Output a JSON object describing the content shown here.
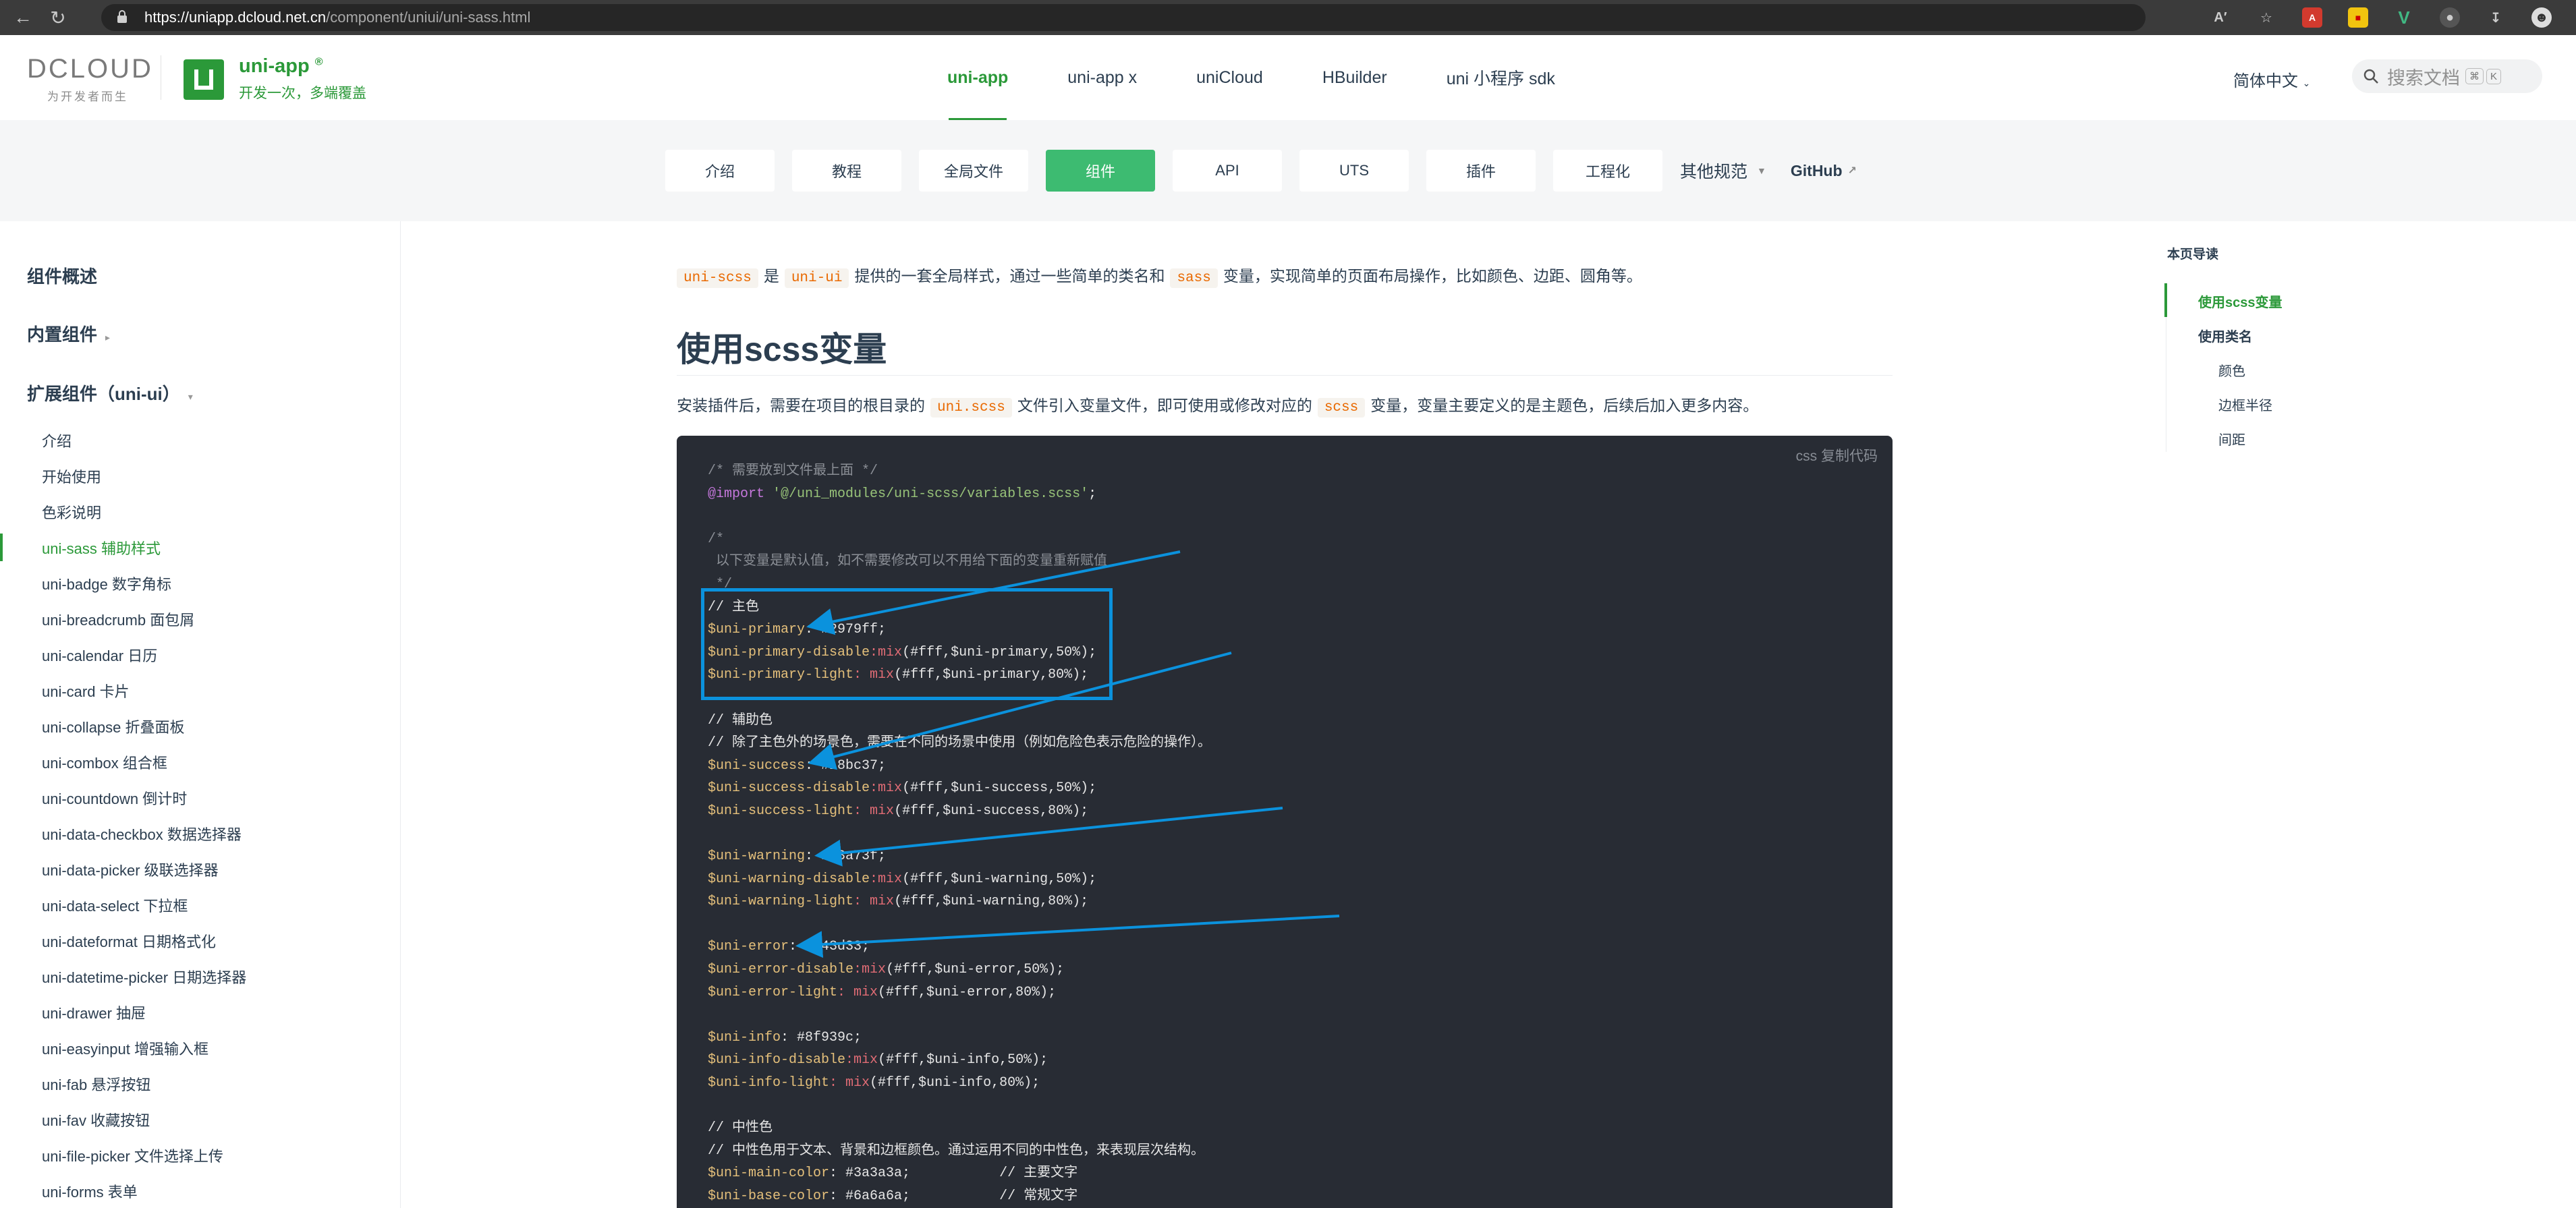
{
  "browser": {
    "url_host": "https://uniapp.dcloud.net.cn",
    "url_path": "/component/uniui/uni-sass.html"
  },
  "header": {
    "logo_text": "DCLOUD",
    "logo_sub": "为开发者而生",
    "brand_title": "uni-app",
    "brand_reg": "®",
    "brand_sub": "开发一次，多端覆盖",
    "nav": [
      "uni-app",
      "uni-app x",
      "uniCloud",
      "HBuilder",
      "uni 小程序 sdk"
    ],
    "lang": "简体中文",
    "search_placeholder": "搜索文档",
    "kbd1": "⌘",
    "kbd2": "K"
  },
  "subnav": {
    "items": [
      "介绍",
      "教程",
      "全局文件",
      "组件",
      "API",
      "UTS",
      "插件",
      "工程化"
    ],
    "other": "其他规范",
    "github": "GitHub"
  },
  "sidebar": {
    "overview": "组件概述",
    "builtin": "内置组件",
    "extended": "扩展组件（uni-ui）",
    "items": [
      "介绍",
      "开始使用",
      "色彩说明",
      "uni-sass 辅助样式",
      "uni-badge 数字角标",
      "uni-breadcrumb 面包屑",
      "uni-calendar 日历",
      "uni-card 卡片",
      "uni-collapse 折叠面板",
      "uni-combox 组合框",
      "uni-countdown 倒计时",
      "uni-data-checkbox 数据选择器",
      "uni-data-picker 级联选择器",
      "uni-data-select 下拉框",
      "uni-dateformat 日期格式化",
      "uni-datetime-picker 日期选择器",
      "uni-drawer 抽屉",
      "uni-easyinput 增强输入框",
      "uni-fab 悬浮按钮",
      "uni-fav 收藏按钮",
      "uni-file-picker 文件选择上传",
      "uni-forms 表单"
    ]
  },
  "content": {
    "intro_code1": "uni-scss",
    "intro_t1": "是",
    "intro_code2": "uni-ui",
    "intro_t2": "提供的一套全局样式，通过一些简单的类名和",
    "intro_code3": "sass",
    "intro_t3": "变量，实现简单的页面布局操作，比如颜色、边距、圆角等。",
    "heading": "使用scss变量",
    "install_t1": "安装插件后，需要在项目的根目录的",
    "install_code1": "uni.scss",
    "install_t2": "文件引入变量文件，即可使用或修改对应的",
    "install_code2": "scss",
    "install_t3": "变量，变量主要定义的是主题色，后续后加入更多内容。",
    "copy_label": "css 复制代码",
    "code": {
      "l1": "/* 需要放到文件最上面 */",
      "l2_kw": "@import",
      "l2_str": "'@/uni_modules/uni-scss/variables.scss'",
      "l2_end": ";",
      "l3": "/*",
      "l4": " 以下变量是默认值，如不需要修改可以不用给下面的变量重新赋值",
      "l5": " */",
      "l6": "// 主色",
      "l7_var": "$uni-primary",
      "l7_val": ": #2979ff;",
      "l8_var": "$uni-primary-disable",
      "l8_fn": ":mix",
      "l8_val": "(#fff,$uni-primary,50%);",
      "l9_var": "$uni-primary-light",
      "l9_fn": ": mix",
      "l9_val": "(#fff,$uni-primary,80%);",
      "l10": "// 辅助色",
      "l11": "// 除了主色外的场景色，需要在不同的场景中使用（例如危险色表示危险的操作）。",
      "l12_var": "$uni-success",
      "l12_val": ": #18bc37;",
      "l13_var": "$uni-success-disable",
      "l13_fn": ":mix",
      "l13_val": "(#fff,$uni-success,50%);",
      "l14_var": "$uni-success-light",
      "l14_fn": ": mix",
      "l14_val": "(#fff,$uni-success,80%);",
      "l15_var": "$uni-warning",
      "l15_val": ": #f3a73f;",
      "l16_var": "$uni-warning-disable",
      "l16_fn": ":mix",
      "l16_val": "(#fff,$uni-warning,50%);",
      "l17_var": "$uni-warning-light",
      "l17_fn": ": mix",
      "l17_val": "(#fff,$uni-warning,80%);",
      "l18_var": "$uni-error",
      "l18_val": ": #e43d33;",
      "l19_var": "$uni-error-disable",
      "l19_fn": ":mix",
      "l19_val": "(#fff,$uni-error,50%);",
      "l20_var": "$uni-error-light",
      "l20_fn": ": mix",
      "l20_val": "(#fff,$uni-error,80%);",
      "l21_var": "$uni-info",
      "l21_val": ": #8f939c;",
      "l22_var": "$uni-info-disable",
      "l22_fn": ":mix",
      "l22_val": "(#fff,$uni-info,50%);",
      "l23_var": "$uni-info-light",
      "l23_fn": ": mix",
      "l23_val": "(#fff,$uni-info,80%);",
      "l24": "// 中性色",
      "l25": "// 中性色用于文本、背景和边框颜色。通过运用不同的中性色，来表现层次结构。",
      "l26_var": "$uni-main-color",
      "l26_val": ": #3a3a3a;",
      "l26_com": "// 主要文字",
      "l27_var": "$uni-base-color",
      "l27_val": ": #6a6a6a;",
      "l27_com": "// 常规文字"
    }
  },
  "toc": {
    "title": "本页导读",
    "items": [
      "使用scss变量",
      "使用类名",
      "颜色",
      "边框半径",
      "间距"
    ]
  },
  "colors": {
    "accent": "#2b9939",
    "pill_active": "#3dbb71",
    "code_bg": "#282c34",
    "annotation": "#0b92dd"
  }
}
